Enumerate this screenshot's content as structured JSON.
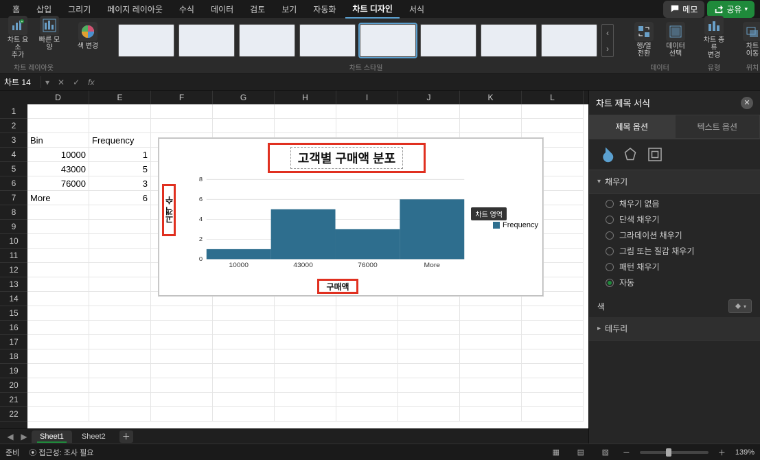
{
  "tabs": [
    "홈",
    "삽입",
    "그리기",
    "페이지 레이아웃",
    "수식",
    "데이터",
    "검토",
    "보기",
    "자동화",
    "차트 디자인",
    "서식"
  ],
  "active_tab": "차트 디자인",
  "memo_label": "메모",
  "share_label": "공유",
  "ribbon": {
    "group_layout": {
      "label": "차트 레이아웃",
      "btn_element": "차트 요소\n추가",
      "btn_quick": "빠른 모양"
    },
    "group_color": {
      "btn_color": "색 변경"
    },
    "group_styles": {
      "label": "차트 스타일"
    },
    "group_data": {
      "label": "데이터",
      "btn_switch": "행/열\n전환",
      "btn_select": "데이터\n선택"
    },
    "group_type": {
      "label": "유형",
      "btn_change": "차트 종류\n변경"
    },
    "group_loc": {
      "label": "위치",
      "btn_move": "차트\n이동"
    }
  },
  "namebox": "차트 14",
  "columns": [
    "D",
    "E",
    "F",
    "G",
    "H",
    "I",
    "J",
    "K",
    "L"
  ],
  "rows": [
    "1",
    "2",
    "3",
    "4",
    "5",
    "6",
    "7",
    "8",
    "9",
    "10",
    "11",
    "12",
    "13",
    "14",
    "15",
    "16",
    "17",
    "18",
    "19",
    "20",
    "21",
    "22"
  ],
  "cells": {
    "D3": "Bin",
    "E3": "Frequency",
    "D4": "10000",
    "E4": "1",
    "D5": "43000",
    "E5": "5",
    "D6": "76000",
    "E6": "3",
    "D7": "More",
    "E7": "6"
  },
  "chart_data": {
    "type": "bar",
    "title": "고객별 구매액 분포",
    "xlabel": "구매액",
    "ylabel": "고객 수",
    "categories": [
      "10000",
      "43000",
      "76000",
      "More"
    ],
    "series": [
      {
        "name": "Frequency",
        "values": [
          1,
          5,
          3,
          6
        ]
      }
    ],
    "ylim": [
      0,
      8
    ],
    "yticks": [
      0,
      2,
      4,
      6,
      8
    ],
    "tooltip": "차트 영역"
  },
  "panel": {
    "title": "차트 제목 서식",
    "tab_title": "제목 옵션",
    "tab_text": "텍스트 옵션",
    "section_fill": "채우기",
    "fill_opts": [
      "채우기 없음",
      "단색 채우기",
      "그라데이션 채우기",
      "그림 또는 질감 채우기",
      "패턴 채우기",
      "자동"
    ],
    "fill_selected": "자동",
    "color_label": "색",
    "section_border": "테두리"
  },
  "sheet_tabs": [
    "Sheet1",
    "Sheet2"
  ],
  "active_sheet": "Sheet1",
  "status": {
    "ready": "준비",
    "access": "접근성: 조사 필요",
    "zoom": "139%"
  }
}
